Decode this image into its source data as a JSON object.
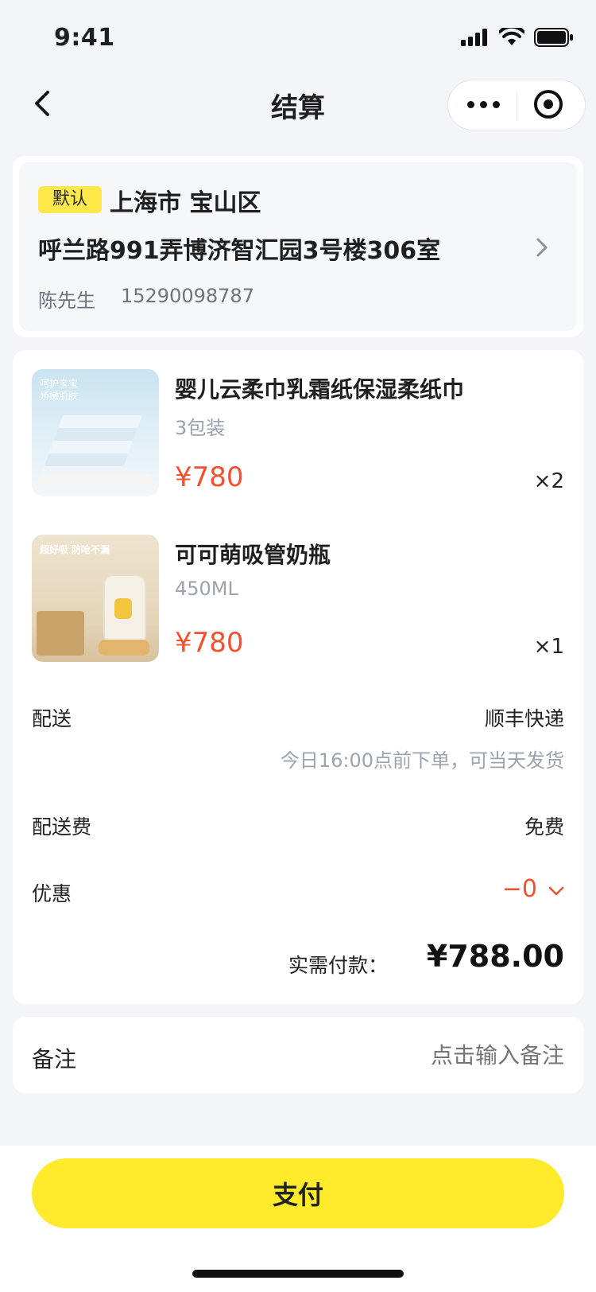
{
  "status_bar": {
    "time": "9:41"
  },
  "nav": {
    "title": "结算"
  },
  "address": {
    "badge": "默认",
    "city": "上海市 宝山区",
    "street": "呼兰路991弄博济智汇园3号楼306室",
    "name": "陈先生",
    "phone": "15290098787"
  },
  "items": [
    {
      "name": "婴儿云柔巾乳霜纸保湿柔纸巾",
      "spec": "3包装",
      "price": "¥780",
      "qty": "×2",
      "thumb_caption": "呵护宝宝\n娇嫩肌肤"
    },
    {
      "name": "可可萌吸管奶瓶",
      "spec": "450ML",
      "price": "¥780",
      "qty": "×1",
      "thumb_caption": "超好吸 防呛不漏"
    }
  ],
  "delivery": {
    "label": "配送",
    "value": "顺丰快递",
    "note": "今日16:00点前下单，可当天发货"
  },
  "shipping_fee": {
    "label": "配送费",
    "value": "免费"
  },
  "discount": {
    "label": "优惠",
    "value": "−0"
  },
  "total": {
    "label": "实需付款：",
    "value": "¥788.00"
  },
  "remark": {
    "label": "备注",
    "placeholder": "点击输入备注"
  },
  "pay_button": {
    "label": "支付"
  },
  "colors": {
    "accent_yellow": "#ffeb2b",
    "price_red": "#f4502e",
    "muted": "#9aa3ae"
  }
}
